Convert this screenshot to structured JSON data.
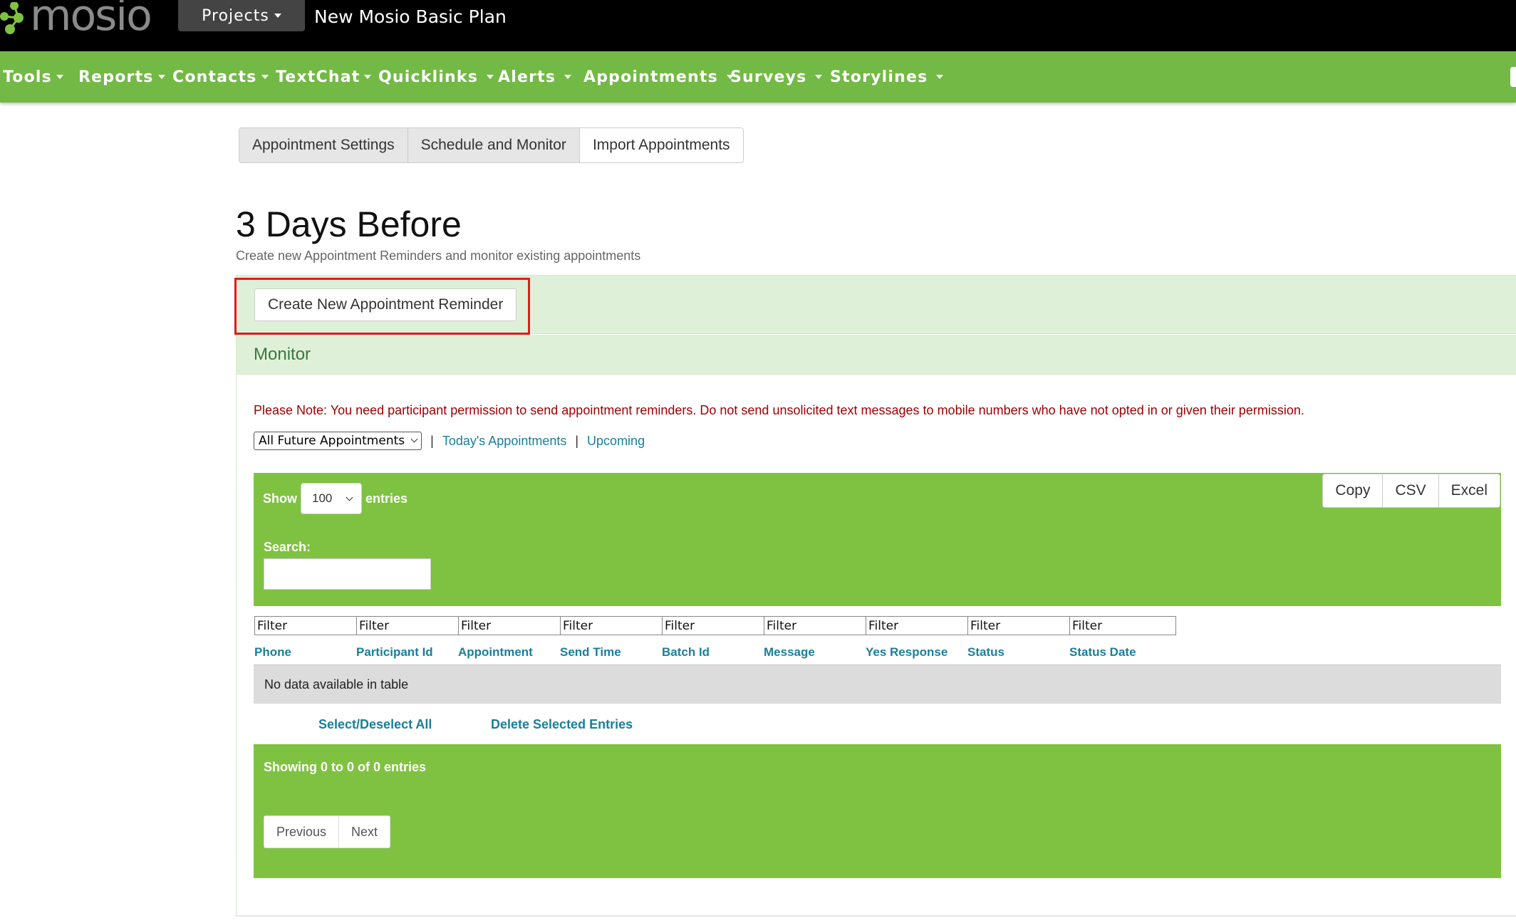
{
  "brand": {
    "name": "mosio",
    "accent_color": "#73b946",
    "logo_icon": "molecule-logo-icon"
  },
  "topbar": {
    "projects_label": "Projects",
    "plan_title": "New Mosio Basic Plan"
  },
  "nav": {
    "items": [
      {
        "label": "Tools"
      },
      {
        "label": "Reports"
      },
      {
        "label": "Contacts"
      },
      {
        "label": "TextChat"
      },
      {
        "label": "Quicklinks"
      },
      {
        "label": "Alerts"
      },
      {
        "label": "Appointments"
      },
      {
        "label": "Surveys"
      },
      {
        "label": "Storylines"
      }
    ]
  },
  "tabs": [
    {
      "label": "Appointment Settings"
    },
    {
      "label": "Schedule and Monitor"
    },
    {
      "label": "Import Appointments"
    }
  ],
  "page": {
    "title": "3 Days Before",
    "subtitle": "Create new Appointment Reminders and monitor existing appointments"
  },
  "panel": {
    "create_button": "Create New Appointment Reminder",
    "monitor_title": "Monitor",
    "note": "Please Note: You need participant permission to send appointment reminders. Do not send unsolicited text messages to mobile numbers who have not opted in or given their permission.",
    "appointment_filter": {
      "selected": "All Future Appointments",
      "separator": "|",
      "links": [
        "Today's Appointments",
        "Upcoming"
      ]
    }
  },
  "table": {
    "show_label": "Show",
    "entries_label": "entries",
    "page_size": "100",
    "search_label": "Search:",
    "search_value": "",
    "export_buttons": [
      "Copy",
      "CSV",
      "Excel"
    ],
    "filter_placeholder": "Filter",
    "columns": [
      "Phone",
      "Participant Id",
      "Appointment",
      "Send Time",
      "Batch Id",
      "Message",
      "Yes Response",
      "Status",
      "Status Date"
    ],
    "empty_message": "No data available in table",
    "select_all": "Select/Deselect All",
    "delete_selected": "Delete Selected Entries",
    "info": "Showing 0 to 0 of 0 entries",
    "pager": {
      "previous": "Previous",
      "next": "Next"
    }
  }
}
